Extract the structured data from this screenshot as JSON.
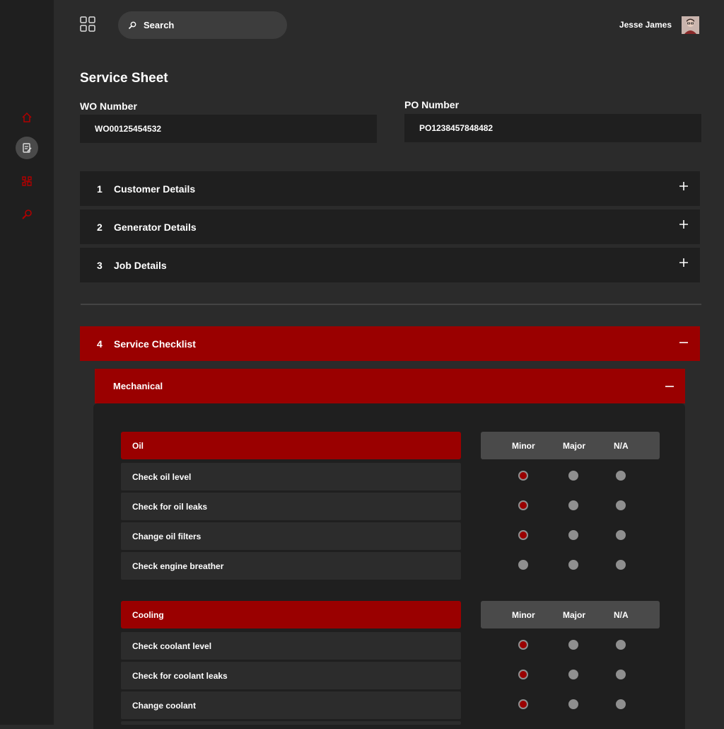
{
  "header": {
    "search_placeholder": "Search",
    "user_name": "Jesse James"
  },
  "page": {
    "title": "Service Sheet",
    "wo_label": "WO Number",
    "wo_value": "WO00125454532",
    "po_label": "PO Number",
    "po_value": "PO1238457848482"
  },
  "sections": [
    {
      "num": "1",
      "label": "Customer Details"
    },
    {
      "num": "2",
      "label": "Generator Details"
    },
    {
      "num": "3",
      "label": "Job Details"
    },
    {
      "num": "4",
      "label": "Service Checklist"
    }
  ],
  "checklist": {
    "subsection": "Mechanical",
    "columns": [
      "Minor",
      "Major",
      "N/A"
    ],
    "groups": [
      {
        "name": "Oil",
        "items": [
          {
            "label": "Check oil level",
            "selected": "Minor"
          },
          {
            "label": "Check for oil leaks",
            "selected": "Minor"
          },
          {
            "label": "Change oil filters",
            "selected": "Minor"
          },
          {
            "label": "Check engine breather",
            "selected": ""
          }
        ]
      },
      {
        "name": "Cooling",
        "items": [
          {
            "label": "Check coolant level",
            "selected": "Minor"
          },
          {
            "label": "Check for coolant leaks",
            "selected": "Minor"
          },
          {
            "label": "Change coolant",
            "selected": "Minor"
          }
        ]
      }
    ]
  },
  "colors": {
    "accent": "#9a0000",
    "sidebar": "#1f1f1f",
    "background": "#2b2b2b"
  }
}
